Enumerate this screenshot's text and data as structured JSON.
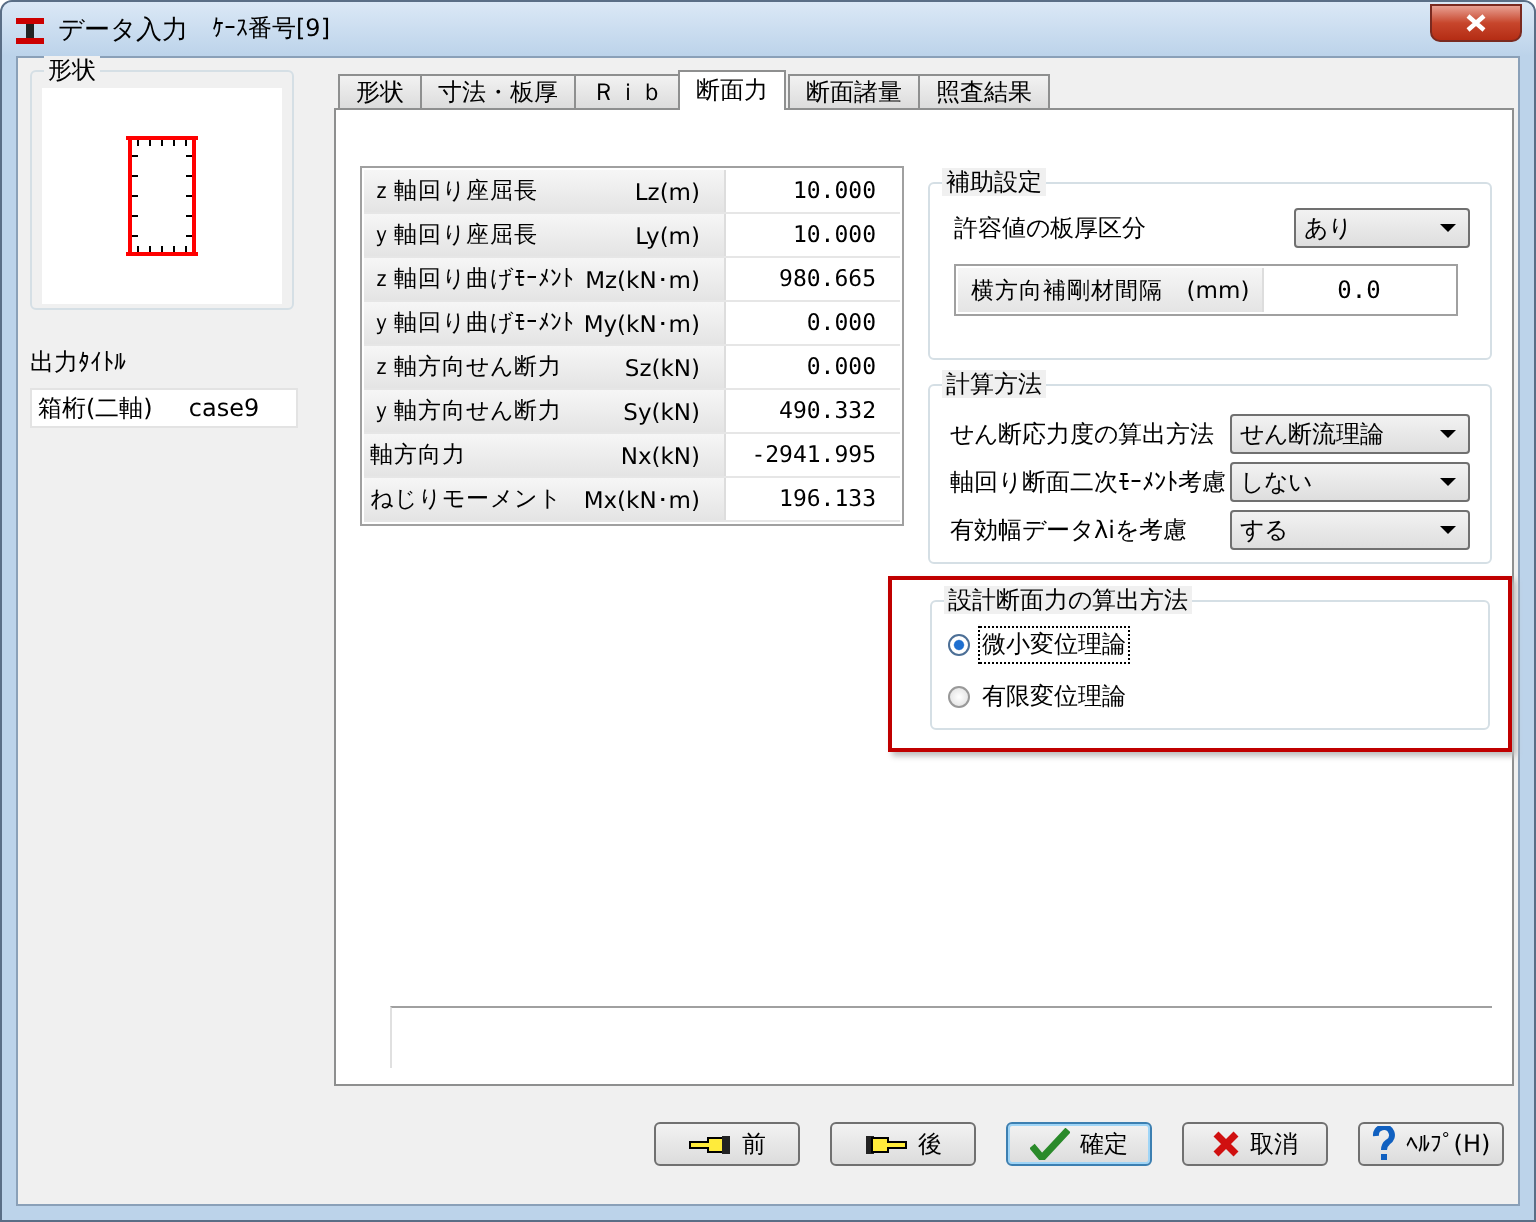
{
  "window": {
    "title": "データ入力",
    "subtitle": "ｹｰｽ番号[9]"
  },
  "shape_group": {
    "title": "形状"
  },
  "output_title": {
    "label": "出力ﾀｲﾄﾙ",
    "name": "箱桁(二軸)",
    "case": "case9"
  },
  "tabs": [
    {
      "label": "形状",
      "selected": false
    },
    {
      "label": "寸法・板厚",
      "selected": false
    },
    {
      "label": "Ｒｉｂ",
      "selected": false
    },
    {
      "label": "断面力",
      "selected": true
    },
    {
      "label": "断面諸量",
      "selected": false
    },
    {
      "label": "照査結果",
      "selected": false
    }
  ],
  "forces": [
    {
      "name": "ｚ軸回り座屈長",
      "symbol": "Lz(m)",
      "value": "10.000"
    },
    {
      "name": "ｙ軸回り座屈長",
      "symbol": "Ly(m)",
      "value": "10.000"
    },
    {
      "name": "ｚ軸回り曲げﾓｰﾒﾝﾄ",
      "symbol": "Mz(kN･m)",
      "value": "980.665"
    },
    {
      "name": "ｙ軸回り曲げﾓｰﾒﾝﾄ",
      "symbol": "My(kN･m)",
      "value": "0.000"
    },
    {
      "name": "ｚ軸方向せん断力",
      "symbol": "Sz(kN)",
      "value": "0.000"
    },
    {
      "name": "ｙ軸方向せん断力",
      "symbol": "Sy(kN)",
      "value": "490.332"
    },
    {
      "name": "軸方向力",
      "symbol": "Nx(kN)",
      "value": "-2941.995"
    },
    {
      "name": "ねじりモーメント",
      "symbol": "Mx(kN･m)",
      "value": "196.133"
    }
  ],
  "aux_settings": {
    "title": "補助設定",
    "label": "許容値の板厚区分",
    "value": "あり",
    "spacing_label": "横方向補剛材間隔　(mm)",
    "spacing_value": "0.0"
  },
  "calc_method": {
    "title": "計算方法",
    "rows": [
      {
        "label": "せん断応力度の算出方法",
        "value": "せん断流理論"
      },
      {
        "label": "軸回り断面二次ﾓｰﾒﾝﾄ考慮",
        "value": "しない"
      },
      {
        "label": "有効幅データλiを考慮",
        "value": "する"
      }
    ]
  },
  "design_force": {
    "title": "設計断面力の算出方法",
    "highlighted": true,
    "options": [
      {
        "label": "微小変位理論",
        "selected": true
      },
      {
        "label": "有限変位理論",
        "selected": false
      }
    ]
  },
  "buttons": [
    {
      "kind": "prev",
      "label": "前",
      "default": false
    },
    {
      "kind": "next",
      "label": "後",
      "default": false
    },
    {
      "kind": "ok",
      "label": "確定",
      "default": true
    },
    {
      "kind": "cancel",
      "label": "取消",
      "default": false
    },
    {
      "kind": "help",
      "label": "ﾍﾙﾌﾟ(H)",
      "default": false
    }
  ]
}
